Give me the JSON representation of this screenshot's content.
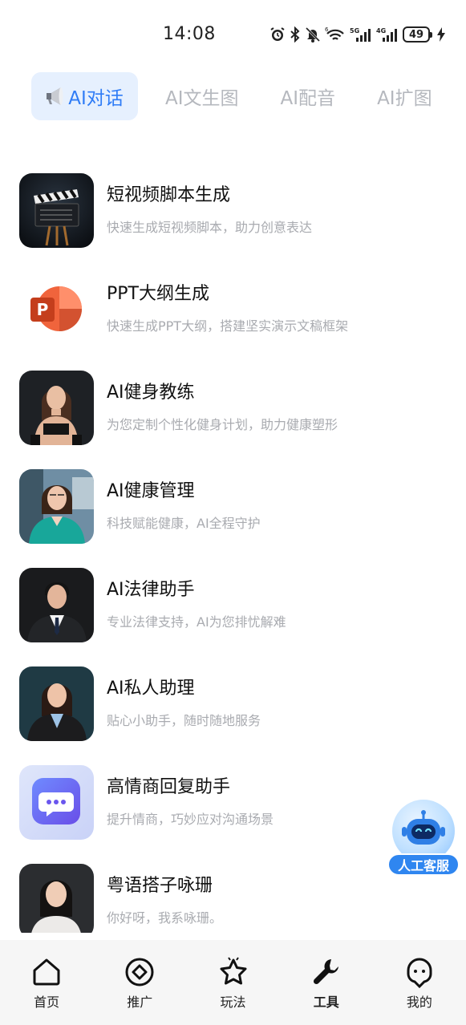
{
  "status_bar": {
    "time": "14:08",
    "battery": "49",
    "icons": [
      "alarm-icon",
      "bluetooth-icon",
      "mute-icon",
      "wifi-6-icon",
      "5g-signal-icon",
      "4g-signal-icon",
      "battery-icon",
      "charging-icon"
    ],
    "signal_labels": {
      "wifi": "6",
      "net1": "5G",
      "net2": "4G"
    }
  },
  "tabs": [
    {
      "label": "AI对话",
      "active": true,
      "icon": "megaphone-icon"
    },
    {
      "label": "AI文生图",
      "active": false
    },
    {
      "label": "AI配音",
      "active": false
    },
    {
      "label": "AI扩图",
      "active": false
    }
  ],
  "list": [
    {
      "title": "短视频脚本生成",
      "desc": "快速生成短视频脚本，助力创意表达",
      "icon": "clapperboard-icon"
    },
    {
      "title": "PPT大纲生成",
      "desc": "快速生成PPT大纲，搭建坚实演示文稿框架",
      "icon": "powerpoint-icon"
    },
    {
      "title": "AI健身教练",
      "desc": "为您定制个性化健身计划，助力健康塑形",
      "icon": "fitness-coach-avatar"
    },
    {
      "title": "AI健康管理",
      "desc": "科技赋能健康，AI全程守护",
      "icon": "doctor-avatar"
    },
    {
      "title": "AI法律助手",
      "desc": "专业法律支持，AI为您排忧解难",
      "icon": "lawyer-avatar"
    },
    {
      "title": "AI私人助理",
      "desc": "贴心小助手，随时随地服务",
      "icon": "assistant-avatar"
    },
    {
      "title": "高情商回复助手",
      "desc": "提升情商，巧妙应对沟通场景",
      "icon": "chat-bubble-icon"
    },
    {
      "title": "粤语搭子咏珊",
      "desc": "你好呀，我系咏珊。",
      "icon": "cantonese-partner-avatar"
    }
  ],
  "service": {
    "label": "人工客服",
    "icon": "robot-icon"
  },
  "bottom_nav": [
    {
      "label": "首页",
      "icon": "home-icon",
      "active": false
    },
    {
      "label": "推广",
      "icon": "promote-icon",
      "active": false
    },
    {
      "label": "玩法",
      "icon": "star-icon",
      "active": false
    },
    {
      "label": "工具",
      "icon": "wrench-icon",
      "active": true
    },
    {
      "label": "我的",
      "icon": "profile-icon",
      "active": false
    }
  ],
  "colors": {
    "accent": "#2f7cf6",
    "tab_active_bg": "#e6f0fe",
    "tab_inactive": "#b5b8be",
    "desc_text": "#a9abb0",
    "service_blue": "#2f86f0",
    "nav_bg": "#f6f6f6"
  }
}
